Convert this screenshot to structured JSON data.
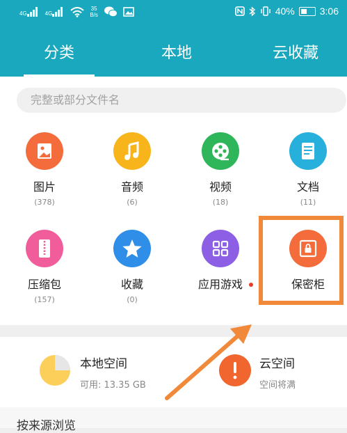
{
  "status_bar": {
    "signal1_label": "4G",
    "signal2_label": "4G",
    "net_speed_value": "35",
    "net_speed_unit": "B/s",
    "battery": "40%",
    "time": "3:06"
  },
  "tabs": [
    {
      "label": "分类",
      "active": true
    },
    {
      "label": "本地",
      "active": false
    },
    {
      "label": "云收藏",
      "active": false
    }
  ],
  "search": {
    "placeholder": "完整或部分文件名"
  },
  "categories": [
    {
      "label": "图片",
      "count": "(378)",
      "color": "#f46c3c",
      "icon": "image-icon"
    },
    {
      "label": "音频",
      "count": "(6)",
      "color": "#f8b51b",
      "icon": "music-note-icon"
    },
    {
      "label": "视频",
      "count": "(18)",
      "color": "#2fb55a",
      "icon": "film-reel-icon"
    },
    {
      "label": "文档",
      "count": "(11)",
      "color": "#27b0dc",
      "icon": "document-icon"
    },
    {
      "label": "压缩包",
      "count": "(157)",
      "color": "#f05d9a",
      "icon": "zip-archive-icon"
    },
    {
      "label": "收藏",
      "count": "(0)",
      "color": "#2f8fe8",
      "icon": "star-icon"
    },
    {
      "label": "应用游戏",
      "count": "",
      "color": "#8c5fe4",
      "icon": "grid-apps-icon"
    },
    {
      "label": "保密柜",
      "count": "",
      "color": "#f46c3c",
      "icon": "safe-box-icon"
    }
  ],
  "storage": {
    "local_title": "本地空间",
    "local_detail": "可用: 13.35 GB",
    "cloud_title": "云空间",
    "cloud_detail": "空间将满"
  },
  "browse_by_source": "按来源浏览",
  "colors": {
    "header": "#1aa8be",
    "highlight": "#f08a3a",
    "cloud_warning": "#f0662e"
  }
}
